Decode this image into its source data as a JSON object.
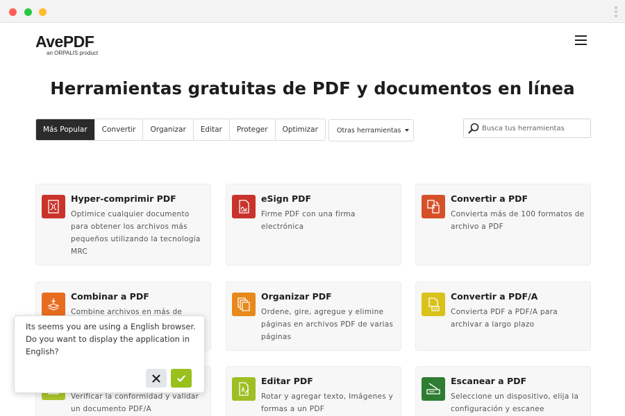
{
  "logo": {
    "name": "AvePDF",
    "tagline": "an ORPALIS product"
  },
  "headline": "Herramientas gratuitas de PDF y documentos en línea",
  "tabs": [
    {
      "label": "Más Popular",
      "active": true
    },
    {
      "label": "Convertir",
      "active": false
    },
    {
      "label": "Organizar",
      "active": false
    },
    {
      "label": "Editar",
      "active": false
    },
    {
      "label": "Proteger",
      "active": false
    },
    {
      "label": "Optimizar",
      "active": false
    }
  ],
  "other_tools": {
    "label": "Otras herramientas"
  },
  "search": {
    "placeholder": "Busca tus herramientas"
  },
  "cards": [
    {
      "title": "Hyper-comprimir PDF",
      "desc": "Optimice cualquier documento para obtener los archivos más pequeños utilizando la tecnología MRC",
      "icon": "compress-icon",
      "color": "#c9332b"
    },
    {
      "title": "eSign PDF",
      "desc": "Firme PDF con una firma electrónica",
      "icon": "esign-icon",
      "color": "#c9332b"
    },
    {
      "title": "Convertir a PDF",
      "desc": "Convierta más de 100 formatos de archivo a PDF",
      "icon": "convert-icon",
      "color": "#d6502a"
    },
    {
      "title": "Combinar a PDF",
      "desc": "Combine archivos en más de",
      "icon": "combine-icon",
      "color": "#e86c1f"
    },
    {
      "title": "Organizar PDF",
      "desc": "Ordene, gire, agregue y elimine páginas en archivos PDF de varias páginas",
      "icon": "organize-icon",
      "color": "#e8891b"
    },
    {
      "title": "Convertir a PDF/A",
      "desc": "Convierta PDF a PDF/A para archivar a largo plazo",
      "icon": "pdfa-icon",
      "color": "#d9c219"
    },
    {
      "title": "",
      "desc": "Verificar la conformidad y validar un documento PDF/A",
      "icon": "validate-icon",
      "color": "#a9c42a"
    },
    {
      "title": "Editar PDF",
      "desc": "Rotar y agregar texto, Imágenes y formas a un PDF",
      "icon": "edit-icon",
      "color": "#9dbf24"
    },
    {
      "title": "Escanear a PDF",
      "desc": "Seleccione un dispositivo, elija la configuración y escanee",
      "icon": "scan-icon",
      "color": "#2e7d32"
    }
  ],
  "popup": {
    "message": "Its seems you are using a English browser. Do you want to display the application in English?",
    "decline_icon": "close-icon",
    "accept_icon": "check-icon"
  }
}
